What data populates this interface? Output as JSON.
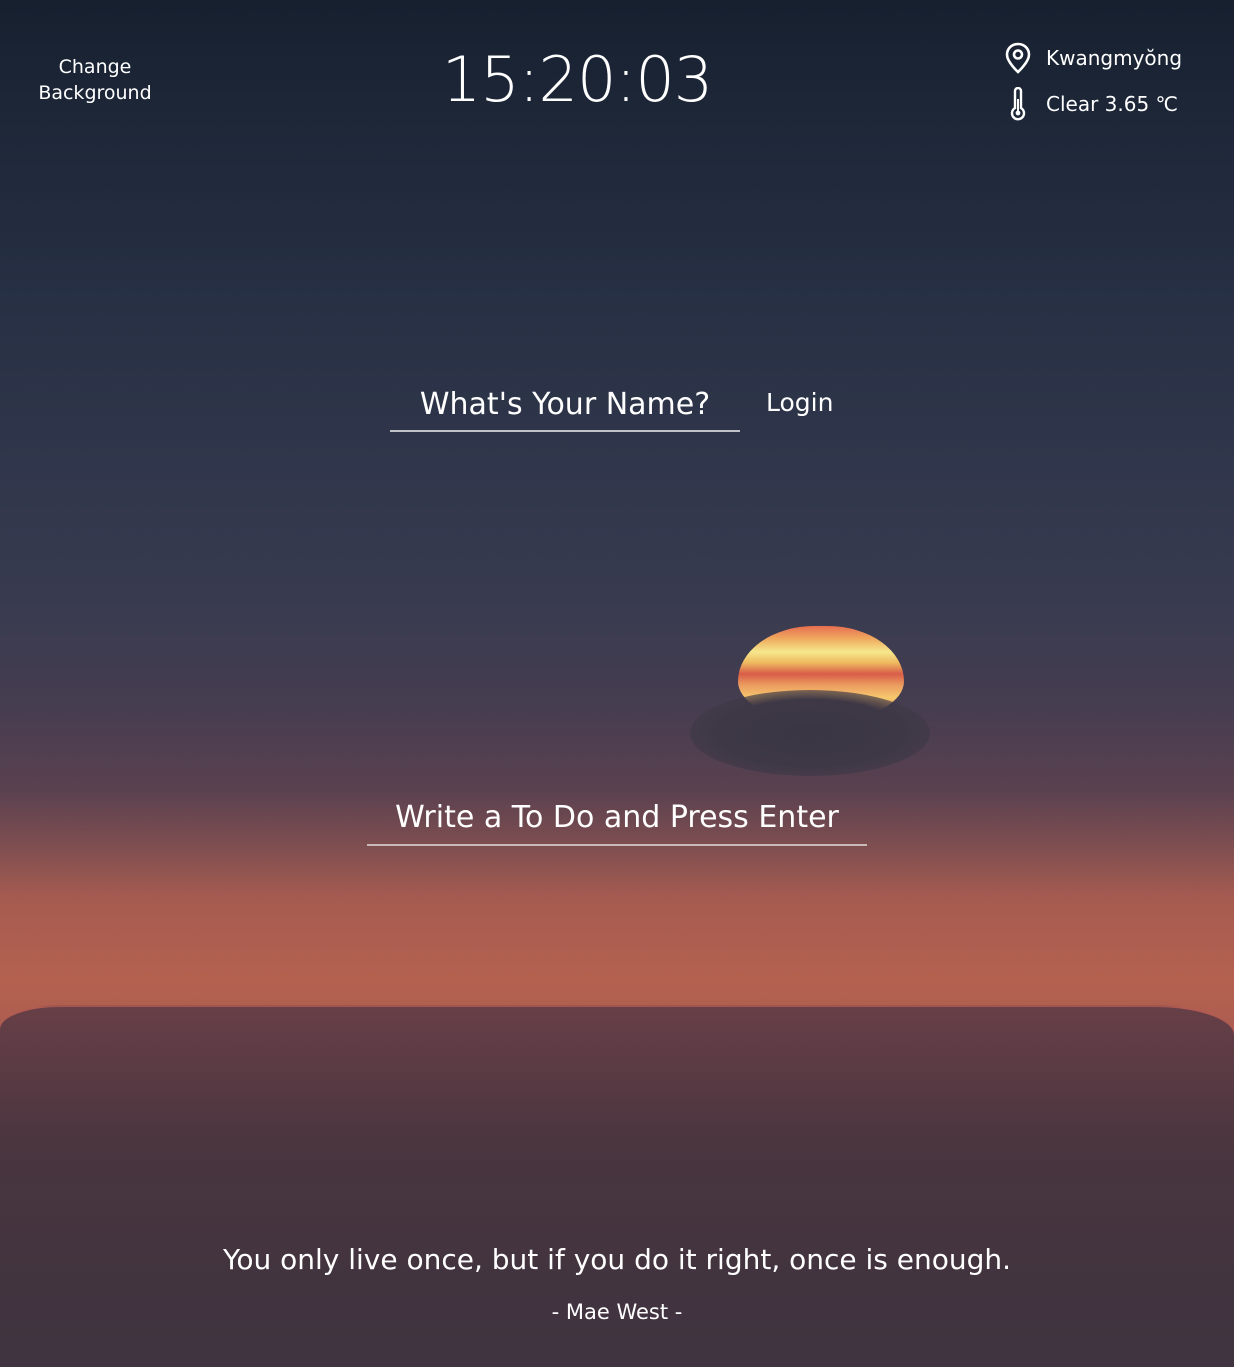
{
  "header": {
    "change_background_label": "Change Background",
    "clock": "15:20:03"
  },
  "weather": {
    "location": "Kwangmyŏng",
    "condition": "Clear 3.65 ℃",
    "location_icon": "map-pin-icon",
    "temperature_icon": "thermometer-icon"
  },
  "login": {
    "name_placeholder": "What's Your Name?",
    "button_label": "Login"
  },
  "todo": {
    "placeholder": "Write a To Do and Press Enter"
  },
  "quote": {
    "text": "You only live once, but if you do it right, once is enough.",
    "author": "- Mae West -"
  },
  "colors": {
    "text": "#ffffff",
    "sky_top": "#16202f",
    "sky_glow": "#b4614f"
  }
}
